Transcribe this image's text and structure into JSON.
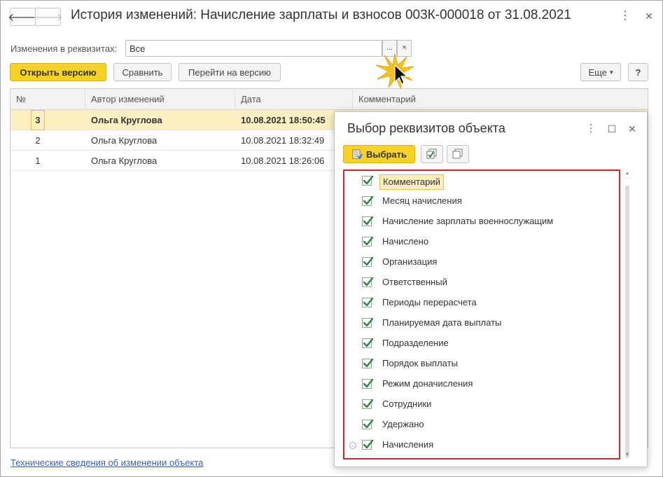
{
  "window": {
    "title": "История изменений: Начисление зарплаты и взносов 003К-000018 от 31.08.2021",
    "back_icon": "arrow-left-icon",
    "forward_icon": "arrow-right-icon",
    "more_icon": "⋮",
    "maximize_icon": "☐",
    "close_icon": "✕"
  },
  "filter": {
    "label": "Изменения в реквизитах:",
    "value": "Все",
    "choose_btn": "...",
    "clear_btn": "×"
  },
  "toolbar": {
    "open_version": "Открыть версию",
    "compare": "Сравнить",
    "go_to_version": "Перейти на версию",
    "more": "Еще",
    "more_arrow": "▾",
    "help": "?"
  },
  "table": {
    "columns": [
      "№",
      "Автор изменений",
      "Дата",
      "Комментарий"
    ],
    "rows": [
      {
        "num": "3",
        "author": "Ольга Круглова",
        "date": "10.08.2021 18:50:45",
        "comment": "",
        "selected": true
      },
      {
        "num": "2",
        "author": "Ольга Круглова",
        "date": "10.08.2021 18:32:49",
        "comment": "",
        "selected": false
      },
      {
        "num": "1",
        "author": "Ольга Круглова",
        "date": "10.08.2021 18:26:06",
        "comment": "",
        "selected": false
      }
    ]
  },
  "footer": {
    "link": "Технические сведения об изменении объекта"
  },
  "dialog": {
    "title": "Выбор реквизитов объекта",
    "more_icon": "⋮",
    "maximize_icon": "☐",
    "close_icon": "✕",
    "select_btn": "Выбрать",
    "items": [
      {
        "label": "Комментарий",
        "checked": true,
        "current": true
      },
      {
        "label": "Месяц начисления",
        "checked": true
      },
      {
        "label": "Начисление зарплаты военнослужащим",
        "checked": true
      },
      {
        "label": "Начислено",
        "checked": true
      },
      {
        "label": "Организация",
        "checked": true
      },
      {
        "label": "Ответственный",
        "checked": true
      },
      {
        "label": "Периоды перерасчета",
        "checked": true
      },
      {
        "label": "Планируемая дата выплаты",
        "checked": true
      },
      {
        "label": "Подразделение",
        "checked": true
      },
      {
        "label": "Порядок выплаты",
        "checked": true
      },
      {
        "label": "Режим доначисления",
        "checked": true
      },
      {
        "label": "Сотрудники",
        "checked": true
      },
      {
        "label": "Удержано",
        "checked": true
      },
      {
        "label": "Начисления",
        "checked": true,
        "collapsible": true
      }
    ]
  },
  "colors": {
    "accent_yellow": "#f7d224",
    "selection": "#fbefc1",
    "highlight_border": "#d3252b",
    "check_green": "#1e8a3a",
    "link": "#3a62a5"
  }
}
